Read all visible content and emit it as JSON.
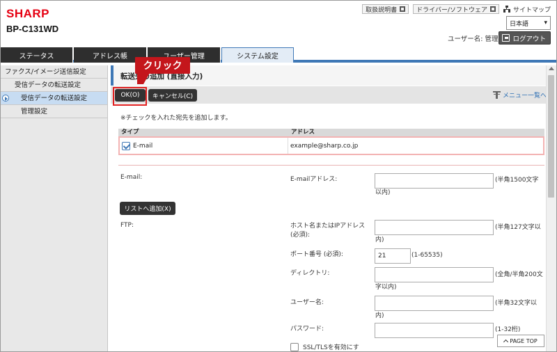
{
  "header": {
    "brand": "SHARP",
    "model": "BP-C131WD",
    "links": [
      {
        "label": "取扱説明書"
      },
      {
        "label": "ドライバー/ソフトウェア"
      }
    ],
    "sitemap_label": "サイトマップ",
    "language": "日本語",
    "user_name": "ユーザー名: 管理者",
    "logout_label": "ログアウト"
  },
  "tabs": [
    {
      "label": "ステータス"
    },
    {
      "label": "アドレス帳"
    },
    {
      "label": "ユーザー管理"
    },
    {
      "label": "システム設定"
    }
  ],
  "sidebar": {
    "items": [
      {
        "label": "ファクス/イメージ送信設定"
      },
      {
        "label": "受信データの転送設定"
      },
      {
        "label": "受信データの転送設定"
      },
      {
        "label": "管理設定"
      }
    ]
  },
  "page": {
    "title": "転送先の追加 (直接入力)",
    "ok_label": "OK(O)",
    "cancel_label": "キャンセル(C)",
    "menu_link": "メニュー一覧へ",
    "note": "※チェックを入れた宛先を追加します。",
    "table": {
      "headers": {
        "type": "タイプ",
        "address": "アドレス"
      },
      "rows": [
        {
          "type": "E-mail",
          "address": "example@sharp.co.jp",
          "checked": true
        }
      ]
    },
    "email_section_label": "E-mail:",
    "email_address_label": "E-mailアドレス:",
    "email_address_value": "",
    "email_hint_1": "(半角1500文字",
    "email_hint_2": "以内)",
    "add_list_button": "リストへ追加(X)",
    "ftp_section_label": "FTP:",
    "host_label_1": "ホスト名またはIPアドレス",
    "host_label_2": "(必須):",
    "host_value": "",
    "host_hint_1": "(半角127文字以",
    "host_hint_2": "内)",
    "port_label": "ポート番号 (必須):",
    "port_value": "21",
    "port_hint": "(1-65535)",
    "dir_label": "ディレクトリ:",
    "dir_value": "",
    "dir_hint_1": "(全角/半角200文",
    "dir_hint_2": "字以内)",
    "user_label": "ユーザー名:",
    "user_value": "",
    "user_hint_1": "(半角32文字以",
    "user_hint_2": "内)",
    "password_label": "パスワード:",
    "password_value": "",
    "password_hint": "(1-32桁)",
    "ssl_label": "SSL/TLSを有効にす"
  },
  "callout": {
    "label": "クリック"
  },
  "page_top_label": "PAGE TOP"
}
